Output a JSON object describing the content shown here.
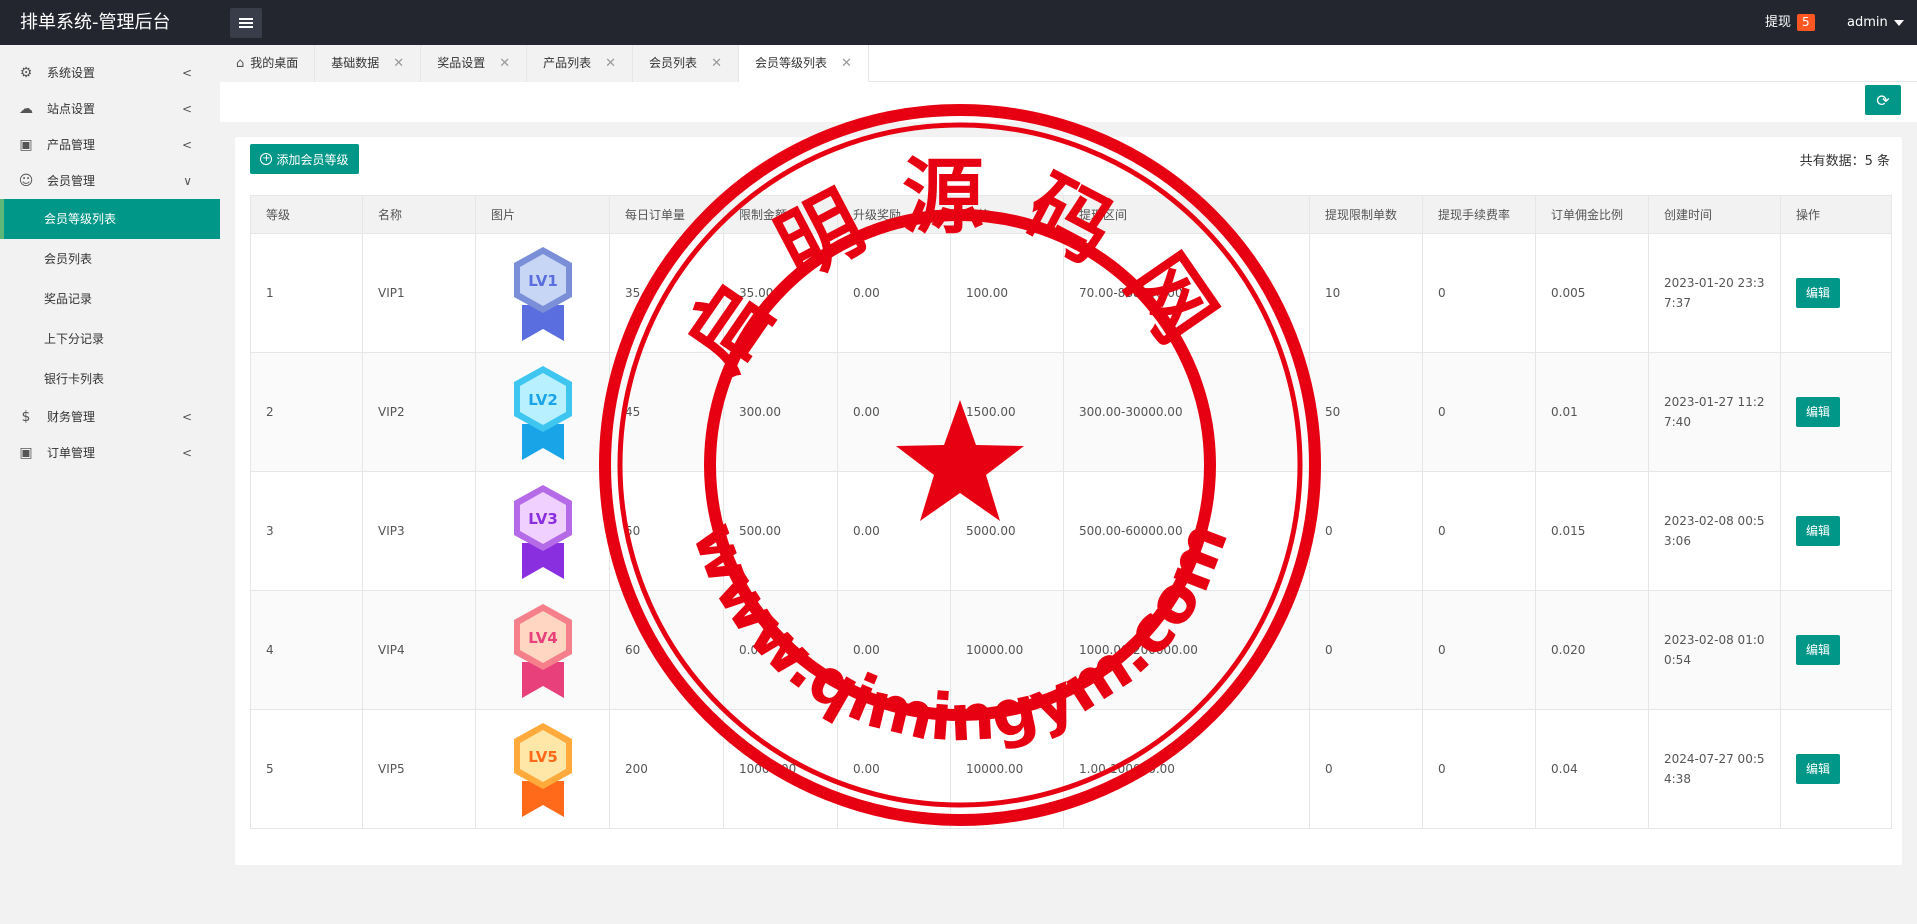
{
  "header": {
    "brand": "排单系统-管理后台",
    "withdraw_label": "提现",
    "withdraw_count": "5",
    "user": "admin"
  },
  "sidebar": {
    "items": [
      {
        "label": "系统设置",
        "icon": "gear-icon"
      },
      {
        "label": "站点设置",
        "icon": "site-icon"
      },
      {
        "label": "产品管理",
        "icon": "box-icon"
      },
      {
        "label": "会员管理",
        "icon": "user-icon"
      },
      {
        "label": "财务管理",
        "icon": "dollar-icon"
      },
      {
        "label": "订单管理",
        "icon": "box-icon"
      }
    ],
    "sub_items": [
      "会员等级列表",
      "会员列表",
      "奖品记录",
      "上下分记录",
      "银行卡列表"
    ]
  },
  "tabs": [
    {
      "label": "我的桌面"
    },
    {
      "label": "基础数据"
    },
    {
      "label": "奖品设置"
    },
    {
      "label": "产品列表"
    },
    {
      "label": "会员列表"
    },
    {
      "label": "会员等级列表"
    }
  ],
  "toolbar": {
    "add_label": "添加会员等级",
    "total_label": "共有数据：5 条"
  },
  "table": {
    "headers": [
      "等级",
      "名称",
      "图片",
      "每日订单量",
      "限制金额",
      "升级奖励",
      "价格",
      "提现区间",
      "提现限制单数",
      "提现手续费率",
      "订单佣金比例",
      "创建时间",
      "操作"
    ],
    "rows": [
      {
        "level": "1",
        "name": "VIP1",
        "badge": "LV1",
        "daily_orders": "35",
        "limit": "35.00",
        "reward": "0.00",
        "price": "100.00",
        "range": "70.00-888888.00",
        "withdraw_limit": "10",
        "fee": "0",
        "commission": "0.005",
        "created": "2023-01-20 23:37:37",
        "action": "编辑"
      },
      {
        "level": "2",
        "name": "VIP2",
        "badge": "LV2",
        "daily_orders": "45",
        "limit": "300.00",
        "reward": "0.00",
        "price": "1500.00",
        "range": "300.00-30000.00",
        "withdraw_limit": "50",
        "fee": "0",
        "commission": "0.01",
        "created": "2023-01-27 11:27:40",
        "action": "编辑"
      },
      {
        "level": "3",
        "name": "VIP3",
        "badge": "LV3",
        "daily_orders": "50",
        "limit": "500.00",
        "reward": "0.00",
        "price": "5000.00",
        "range": "500.00-60000.00",
        "withdraw_limit": "0",
        "fee": "0",
        "commission": "0.015",
        "created": "2023-02-08 00:53:06",
        "action": "编辑"
      },
      {
        "level": "4",
        "name": "VIP4",
        "badge": "LV4",
        "daily_orders": "60",
        "limit": "0.00",
        "reward": "0.00",
        "price": "10000.00",
        "range": "1000.00-200000.00",
        "withdraw_limit": "0",
        "fee": "0",
        "commission": "0.020",
        "created": "2023-02-08 01:00:54",
        "action": "编辑"
      },
      {
        "level": "5",
        "name": "VIP5",
        "badge": "LV5",
        "daily_orders": "200",
        "limit": "10000.00",
        "reward": "0.00",
        "price": "10000.00",
        "range": "1.00-100000.00",
        "withdraw_limit": "0",
        "fee": "0",
        "commission": "0.04",
        "created": "2024-07-27 00:54:38",
        "action": "编辑"
      }
    ]
  },
  "watermark": {
    "top_text": "启明源码网",
    "bottom_text": "www.qimingym.com"
  },
  "colors": {
    "accent": "#009688",
    "header_bg": "#23262e",
    "badge": "#ff5722",
    "stamp": "#e60012"
  }
}
